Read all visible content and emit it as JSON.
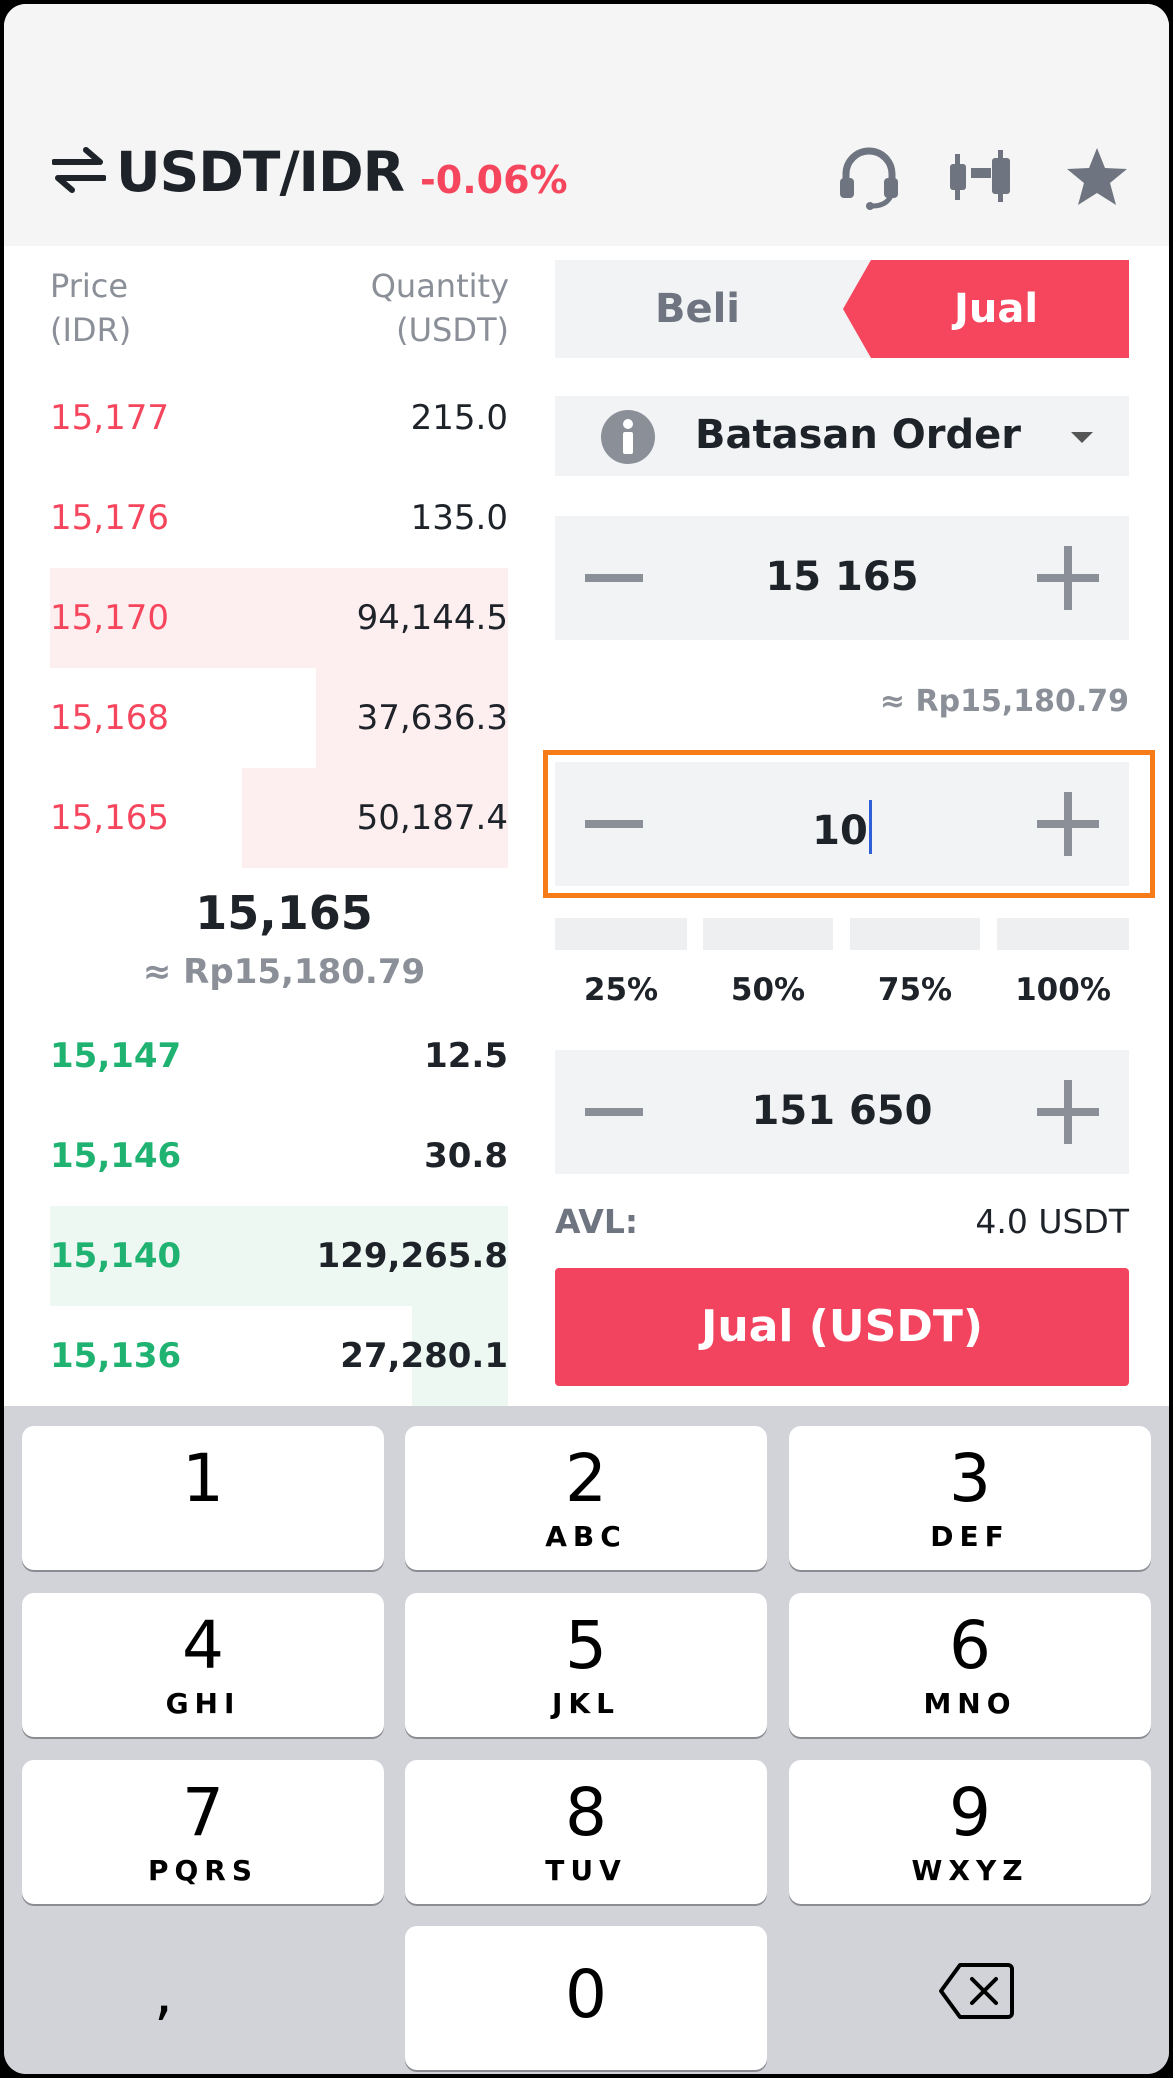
{
  "header": {
    "pair": "USDT/IDR",
    "change": "-0.06%"
  },
  "book": {
    "price_header_1": "Price",
    "price_header_2": "(IDR)",
    "qty_header_1": "Quantity",
    "qty_header_2": "(USDT)",
    "asks": [
      {
        "price": "15,177",
        "qty": "215.0",
        "depth": 0
      },
      {
        "price": "15,176",
        "qty": "135.0",
        "depth": 0
      },
      {
        "price": "15,170",
        "qty": "94,144.5",
        "depth": 1.0
      },
      {
        "price": "15,168",
        "qty": "37,636.3",
        "depth": 0.42
      },
      {
        "price": "15,165",
        "qty": "50,187.4",
        "depth": 0.58
      }
    ],
    "mid_price": "15,165",
    "mid_approx": "≈ Rp15,180.79",
    "bids": [
      {
        "price": "15,147",
        "qty": "12.5",
        "depth": 0
      },
      {
        "price": "15,146",
        "qty": "30.8",
        "depth": 0
      },
      {
        "price": "15,140",
        "qty": "129,265.8",
        "depth": 1.0
      },
      {
        "price": "15,136",
        "qty": "27,280.1",
        "depth": 0.21
      }
    ]
  },
  "form": {
    "tab_buy": "Beli",
    "tab_sell": "Jual",
    "order_type": "Batasan Order",
    "price_value": "15 165",
    "price_approx": "≈ Rp15,180.79",
    "amount_value": "10",
    "percentages": [
      "25%",
      "50%",
      "75%",
      "100%"
    ],
    "total_value": "151 650",
    "avl_label": "AVL:",
    "avl_value": "4.0 USDT",
    "submit_label": "Jual (USDT)"
  },
  "keyboard": {
    "keys": [
      {
        "digit": "1",
        "letters": ""
      },
      {
        "digit": "2",
        "letters": "ABC"
      },
      {
        "digit": "3",
        "letters": "DEF"
      },
      {
        "digit": "4",
        "letters": "GHI"
      },
      {
        "digit": "5",
        "letters": "JKL"
      },
      {
        "digit": "6",
        "letters": "MNO"
      },
      {
        "digit": "7",
        "letters": "PQRS"
      },
      {
        "digit": "8",
        "letters": "TUV"
      },
      {
        "digit": "9",
        "letters": "WXYZ"
      }
    ],
    "zero": "0",
    "comma": ","
  },
  "colors": {
    "sell": "#f6465d",
    "buy": "#1fb271",
    "focus": "#f77b17"
  },
  "icons": [
    "swap-icon",
    "headset-icon",
    "candlestick-icon",
    "star-icon",
    "info-icon",
    "caret-down-icon",
    "minus-icon",
    "plus-icon",
    "backspace-icon"
  ]
}
